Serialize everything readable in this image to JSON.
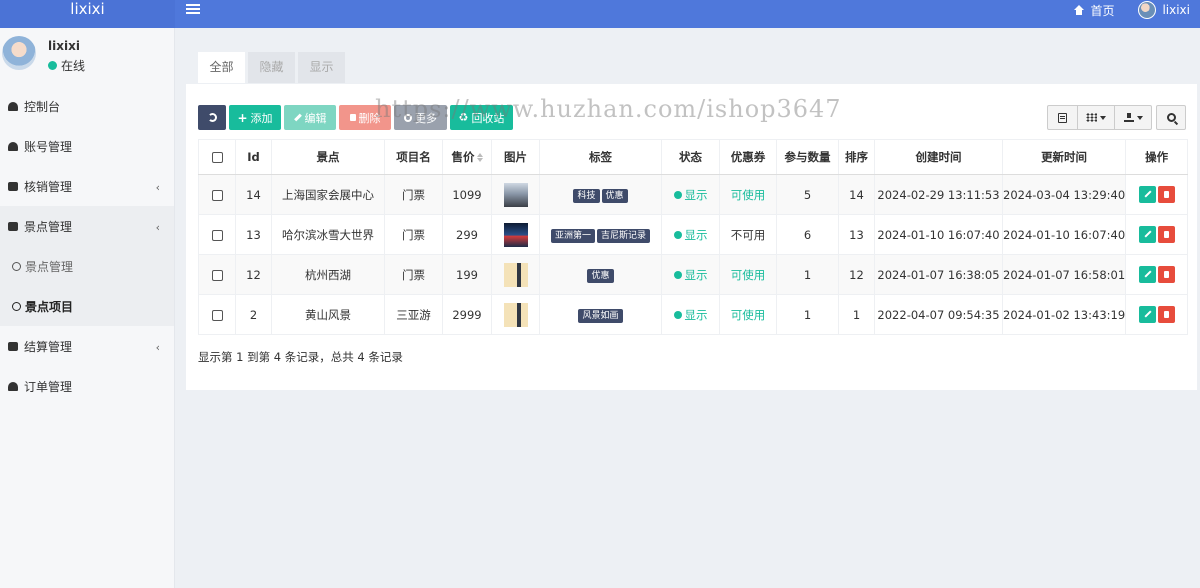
{
  "brand": "lixixi",
  "topbar": {
    "home_label": "首页",
    "user_name": "lixixi"
  },
  "sidebar": {
    "user_name": "lixixi",
    "user_status": "在线",
    "items": [
      {
        "label": "控制台"
      },
      {
        "label": "账号管理"
      },
      {
        "label": "核销管理"
      },
      {
        "label": "景点管理"
      },
      {
        "label": "景点管理"
      },
      {
        "label": "景点项目"
      },
      {
        "label": "结算管理"
      },
      {
        "label": "订单管理"
      }
    ]
  },
  "tabs": [
    {
      "label": "全部"
    },
    {
      "label": "隐藏"
    },
    {
      "label": "显示"
    }
  ],
  "toolbar": {
    "add_label": "添加",
    "edit_label": "编辑",
    "delete_label": "删除",
    "more_label": "更多",
    "recycle_label": "回收站"
  },
  "table": {
    "headers": [
      "Id",
      "景点",
      "项目名",
      "售价",
      "图片",
      "标签",
      "状态",
      "优惠券",
      "参与数量",
      "排序",
      "创建时间",
      "更新时间",
      "操作"
    ],
    "rows": [
      {
        "id": "14",
        "spot": "上海国家会展中心",
        "project": "门票",
        "price": "1099",
        "tags": [
          "科技",
          "优惠"
        ],
        "status": "显示",
        "coupon": "可使用",
        "count": "5",
        "sort": "14",
        "created": "2024-02-29 13:11:53",
        "updated": "2024-03-04 13:29:40"
      },
      {
        "id": "13",
        "spot": "哈尔滨冰雪大世界",
        "project": "门票",
        "price": "299",
        "tags": [
          "亚洲第一",
          "吉尼斯记录"
        ],
        "status": "显示",
        "coupon": "不可用",
        "count": "6",
        "sort": "13",
        "created": "2024-01-10 16:07:40",
        "updated": "2024-01-10 16:07:40"
      },
      {
        "id": "12",
        "spot": "杭州西湖",
        "project": "门票",
        "price": "199",
        "tags": [
          "优惠"
        ],
        "status": "显示",
        "coupon": "可使用",
        "count": "1",
        "sort": "12",
        "created": "2024-01-07 16:38:05",
        "updated": "2024-01-07 16:58:01"
      },
      {
        "id": "2",
        "spot": "黄山风景",
        "project": "三亚游",
        "price": "2999",
        "tags": [
          "风景如画"
        ],
        "status": "显示",
        "coupon": "可使用",
        "count": "1",
        "sort": "1",
        "created": "2022-04-07 09:54:35",
        "updated": "2024-01-02 13:43:19"
      }
    ]
  },
  "summary": "显示第 1 到第 4 条记录，总共 4 条记录",
  "watermark": "https://www.huzhan.com/ishop3647",
  "colors": {
    "accent": "#18bc9c",
    "topbar": "#4f78db",
    "danger": "#e74c3c",
    "dark": "#3f4b6a"
  }
}
